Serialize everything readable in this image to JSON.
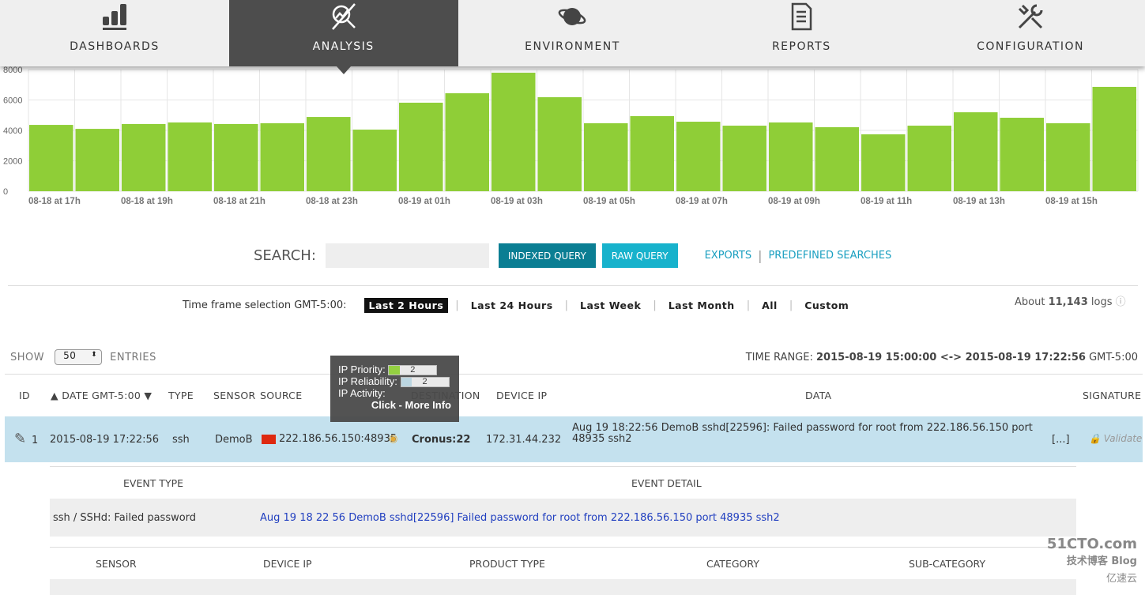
{
  "nav": {
    "items": [
      {
        "label": "DASHBOARDS",
        "icon": "bar-chart-icon"
      },
      {
        "label": "ANALYSIS",
        "icon": "analysis-magnifier-icon",
        "active": true
      },
      {
        "label": "ENVIRONMENT",
        "icon": "planet-icon"
      },
      {
        "label": "REPORTS",
        "icon": "document-icon"
      },
      {
        "label": "CONFIGURATION",
        "icon": "tools-icon"
      }
    ]
  },
  "chart_data": {
    "type": "bar",
    "color": "#8fce37",
    "ylim": [
      0,
      8000
    ],
    "yticks": [
      "0",
      "2000",
      "4000",
      "6000",
      "8000"
    ],
    "xlabels": [
      "08-18 at 17h",
      "08-18 at 19h",
      "08-18 at 21h",
      "08-18 at 23h",
      "08-19 at 01h",
      "08-19 at 03h",
      "08-19 at 05h",
      "08-19 at 07h",
      "08-19 at 09h",
      "08-19 at 11h",
      "08-19 at 13h",
      "08-19 at 15h"
    ],
    "values": [
      4360,
      4100,
      4420,
      4520,
      4420,
      4470,
      4880,
      4050,
      5820,
      6440,
      7790,
      6180,
      4470,
      4940,
      4570,
      4310,
      4520,
      4210,
      3740,
      4310,
      5190,
      4830,
      4470,
      6860
    ]
  },
  "search": {
    "label": "SEARCH:",
    "value": "",
    "indexed": "INDEXED QUERY",
    "raw": "RAW QUERY",
    "exports": "EXPORTS",
    "predefined": "PREDEFINED SEARCHES"
  },
  "timeframe": {
    "label": "Time frame selection",
    "tz": "GMT-5:00:",
    "options": [
      "Last 2 Hours",
      "Last 24 Hours",
      "Last Week",
      "Last Month",
      "All",
      "Custom"
    ],
    "selected": "Last 2 Hours"
  },
  "about": {
    "prefix": "About",
    "count": "11,143",
    "suffix": "logs"
  },
  "entries": {
    "show": "SHOW",
    "value": "50",
    "label": "ENTRIES"
  },
  "range": {
    "label": "TIME RANGE:",
    "value": "2015-08-19 15:00:00 <-> 2015-08-19 17:22:56",
    "tz": "GMT-5:00"
  },
  "columns": [
    "ID",
    "DATE GMT-5:00",
    "TYPE",
    "SENSOR",
    "SOURCE",
    "DESTINATION",
    "DEVICE IP",
    "DATA",
    "SIGNATURE"
  ],
  "row": {
    "id": "1",
    "date": "2015-08-19 17:22:56",
    "type": "ssh",
    "sensor": "DemoB",
    "source": "222.186.56.150:48935",
    "destination": "Cronus:22",
    "device_ip": "172.31.44.232",
    "data": "Aug 19 18:22:56 DemoB sshd[22596]: Failed password for root from 222.186.56.150 port 48935 ssh2",
    "more": "[...]",
    "signature": "Validate"
  },
  "tooltip": {
    "priority_label": "IP Priority:",
    "priority": "2",
    "reliability_label": "IP Reliability:",
    "reliability": "2",
    "activity_label": "IP Activity:",
    "more": "Click - More Info"
  },
  "detail": {
    "event_type_h": "EVENT TYPE",
    "event_detail_h": "EVENT DETAIL",
    "event_type": "ssh / SSHd: Failed password",
    "event_detail": "Aug 19 18 22 56 DemoB sshd[22596] Failed password for root from 222.186.56.150 port 48935 ssh2",
    "cols2": [
      "SENSOR",
      "DEVICE IP",
      "PRODUCT TYPE",
      "CATEGORY",
      "SUB-CATEGORY"
    ]
  },
  "watermark": {
    "line1": "51CTO.com",
    "line2": "技术博客 Blog",
    "line3": "亿速云"
  }
}
